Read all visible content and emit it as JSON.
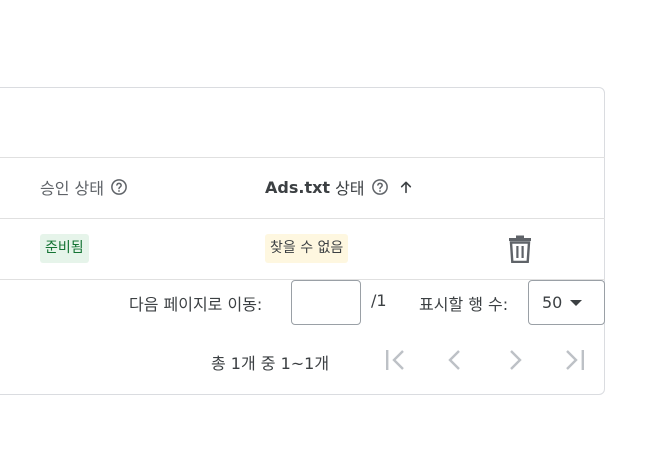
{
  "table": {
    "columns": [
      {
        "label": "승인 상태",
        "icon": "help-circle-icon"
      },
      {
        "label_bold": "Ads.txt",
        "label_rest": "상태",
        "icon": "help-circle-icon",
        "sort": "arrow-up-icon"
      }
    ],
    "rows": [
      {
        "approval_status": "준비됨",
        "ads_txt_status": "찾을 수 없음",
        "action_icon": "trash-icon"
      }
    ]
  },
  "pagination": {
    "goto_label": "다음 페이지로 이동:",
    "page_input_value": "",
    "total_pages": "/1",
    "rows_label": "표시할 행 수:",
    "rows_per_page": "50",
    "summary": "총 1개 중 1~1개",
    "nav_icons": [
      "first-page-icon",
      "prev-page-icon",
      "next-page-icon",
      "last-page-icon"
    ]
  },
  "colors": {
    "ready_chip_bg": "#e6f4ea",
    "ready_chip_text": "#137333",
    "notfound_chip_bg": "#fef7e0",
    "border": "#dadce0",
    "disabled_icon": "#bdc1c6"
  }
}
